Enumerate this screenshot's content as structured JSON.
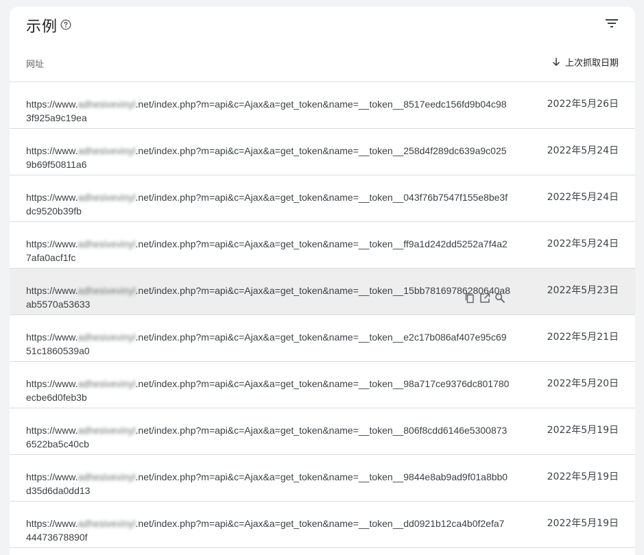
{
  "card": {
    "title": "示例"
  },
  "table": {
    "url_header": "网址",
    "date_header": "上次抓取日期",
    "rows": [
      {
        "prefix": "https://www.",
        "masked": "adhesivevinyl",
        "suffix": ".net/index.php?m=api&c=Ajax&a=get_token&name=__token__8517eedc156fd9b04c98",
        "line2": "3f925a9c19ea",
        "date": "2022年5月26日"
      },
      {
        "prefix": "https://www.",
        "masked": "adhesivevinyl",
        "suffix": ".net/index.php?m=api&c=Ajax&a=get_token&name=__token__258d4f289dc639a9c025",
        "line2": "9b69f50811a6",
        "date": "2022年5月24日"
      },
      {
        "prefix": "https://www.",
        "masked": "adhesivevinyl",
        "suffix": ".net/index.php?m=api&c=Ajax&a=get_token&name=__token__043f76b7547f155e8be3f",
        "line2": "dc9520b39fb",
        "date": "2022年5月24日"
      },
      {
        "prefix": "https://www.",
        "masked": "adhesivevinyl",
        "suffix": ".net/index.php?m=api&c=Ajax&a=get_token&name=__token__ff9a1d242dd5252a7f4a2",
        "line2": "7afa0acf1fc",
        "date": "2022年5月24日"
      },
      {
        "prefix": "https://www.",
        "masked": "adhesivevinyl",
        "suffix": ".net/index.php?m=api&c=Ajax&a=get_token&name=__token__15bb78169786280640a8",
        "line2": "ab5570a53633",
        "date": "2022年5月23日"
      },
      {
        "prefix": "https://www.",
        "masked": "adhesivevinyl",
        "suffix": ".net/index.php?m=api&c=Ajax&a=get_token&name=__token__e2c17b086af407e95c69",
        "line2": "51c1860539a0",
        "date": "2022年5月21日"
      },
      {
        "prefix": "https://www.",
        "masked": "adhesivevinyl",
        "suffix": ".net/index.php?m=api&c=Ajax&a=get_token&name=__token__98a717ce9376dc801780",
        "line2": "ecbe6d0feb3b",
        "date": "2022年5月20日"
      },
      {
        "prefix": "https://www.",
        "masked": "adhesivevinyl",
        "suffix": ".net/index.php?m=api&c=Ajax&a=get_token&name=__token__806f8cdd6146e5300873",
        "line2": "6522ba5c40cb",
        "date": "2022年5月19日"
      },
      {
        "prefix": "https://www.",
        "masked": "adhesivevinyl",
        "suffix": ".net/index.php?m=api&c=Ajax&a=get_token&name=__token__9844e8ab9ad9f01a8bb0",
        "line2": "d35d6da0dd13",
        "date": "2022年5月19日"
      },
      {
        "prefix": "https://www.",
        "masked": "adhesivevinyl",
        "suffix": ".net/index.php?m=api&c=Ajax&a=get_token&name=__token__dd0921b12ca4b0f2efa7",
        "line2": "44473678890f",
        "date": "2022年5月19日"
      }
    ]
  },
  "hovered_row": 4,
  "icons": {
    "help": "help-circle-icon",
    "filter": "filter-list-icon",
    "sort": "arrow-downward-icon",
    "copy": "copy-icon",
    "open": "open-in-new-icon",
    "inspect": "search-icon"
  },
  "colors": {
    "background": "#f1f3f4",
    "card": "#ffffff",
    "divider": "#dadce0",
    "hover_row": "#eeeeee",
    "text": "#3c4043",
    "secondary_text": "#5f6368"
  }
}
